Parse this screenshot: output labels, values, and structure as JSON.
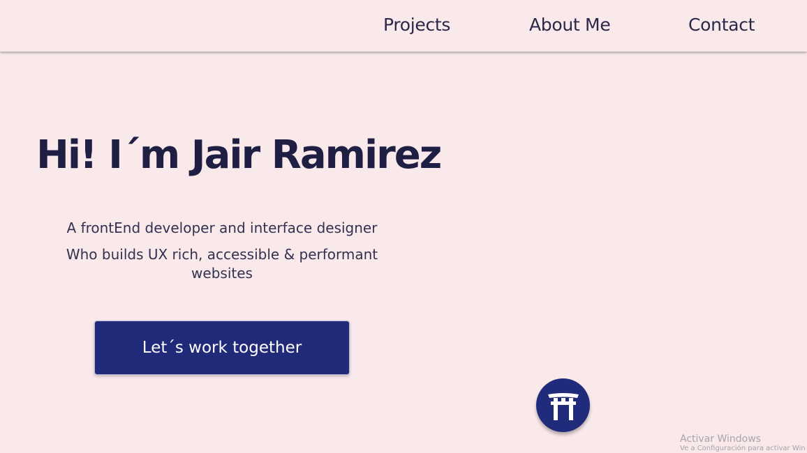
{
  "nav": {
    "items": [
      {
        "label": "Projects"
      },
      {
        "label": "About Me"
      },
      {
        "label": "Contact"
      }
    ]
  },
  "hero": {
    "title": "Hi! I´m Jair Ramirez",
    "subtitle_line1": "A frontEnd developer and interface designer",
    "subtitle_line2": "Who builds UX rich, accessible & performant websites",
    "cta_label": "Let´s work together"
  },
  "badge": {
    "icon": "torii-gate-icon"
  },
  "watermark": {
    "title": "Activar Windows",
    "subtitle": "Ve a Configuración para activar Win"
  },
  "colors": {
    "background": "#f9e9eb",
    "heading": "#1f1f43",
    "accent": "#212b7b"
  }
}
